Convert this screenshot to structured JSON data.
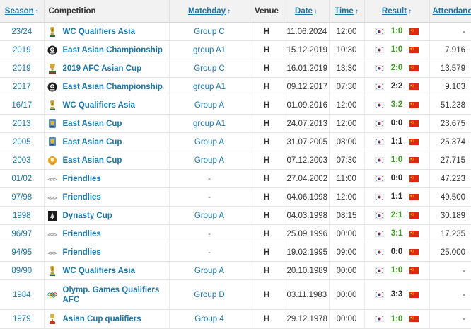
{
  "header": {
    "season": "Season",
    "competition": "Competition",
    "matchday": "Matchday",
    "venue": "Venue",
    "date": "Date",
    "time": "Time",
    "result": "Result",
    "attendance": "Attendance",
    "sort_icon": "↕",
    "sort_active_icon": "↓"
  },
  "rows": [
    {
      "season": "23/24",
      "competition": "WC Qualifiers Asia",
      "logo": "wc-icon",
      "matchday": "Group C",
      "venue": "H",
      "date": "11.06.2024",
      "time": "12:00",
      "result": "1:0",
      "outcome": "w",
      "attendance": "-"
    },
    {
      "season": "2019",
      "competition": "East Asian Championship",
      "logo": "eaff-icon",
      "matchday": "group A1",
      "venue": "H",
      "date": "15.12.2019",
      "time": "10:30",
      "result": "1:0",
      "outcome": "w",
      "attendance": "7.916"
    },
    {
      "season": "2019",
      "competition": "2019 AFC Asian Cup",
      "logo": "afc-icon",
      "matchday": "Group C",
      "venue": "H",
      "date": "16.01.2019",
      "time": "13:30",
      "result": "2:0",
      "outcome": "w",
      "attendance": "13.579"
    },
    {
      "season": "2017",
      "competition": "East Asian Championship",
      "logo": "eaff-icon",
      "matchday": "group A1",
      "venue": "H",
      "date": "09.12.2017",
      "time": "07:30",
      "result": "2:2",
      "outcome": "d",
      "attendance": "9.103"
    },
    {
      "season": "16/17",
      "competition": "WC Qualifiers Asia",
      "logo": "wc-icon",
      "matchday": "Group A",
      "venue": "H",
      "date": "01.09.2016",
      "time": "12:00",
      "result": "3:2",
      "outcome": "w",
      "attendance": "51.238"
    },
    {
      "season": "2013",
      "competition": "East Asian Cup",
      "logo": "eac-icon",
      "matchday": "group A1",
      "venue": "H",
      "date": "24.07.2013",
      "time": "12:00",
      "result": "0:0",
      "outcome": "d",
      "attendance": "23.675"
    },
    {
      "season": "2005",
      "competition": "East Asian Cup",
      "logo": "eac-icon",
      "matchday": "Group A",
      "venue": "H",
      "date": "31.07.2005",
      "time": "08:00",
      "result": "1:1",
      "outcome": "d",
      "attendance": "25.374"
    },
    {
      "season": "2003",
      "competition": "East Asian Cup",
      "logo": "eac-gold-icon",
      "matchday": "Group A",
      "venue": "H",
      "date": "07.12.2003",
      "time": "07:30",
      "result": "1:0",
      "outcome": "w",
      "attendance": "27.715"
    },
    {
      "season": "01/02",
      "competition": "Friendlies",
      "logo": "friendlies-icon",
      "matchday": "-",
      "venue": "H",
      "date": "27.04.2002",
      "time": "11:00",
      "result": "0:0",
      "outcome": "d",
      "attendance": "47.223"
    },
    {
      "season": "97/98",
      "competition": "Friendlies",
      "logo": "friendlies-icon",
      "matchday": "-",
      "venue": "H",
      "date": "04.06.1998",
      "time": "12:00",
      "result": "1:1",
      "outcome": "d",
      "attendance": "49.500"
    },
    {
      "season": "1998",
      "competition": "Dynasty Cup",
      "logo": "dynasty-icon",
      "matchday": "Group A",
      "venue": "H",
      "date": "04.03.1998",
      "time": "08:15",
      "result": "2:1",
      "outcome": "w",
      "attendance": "30.189"
    },
    {
      "season": "96/97",
      "competition": "Friendlies",
      "logo": "friendlies-icon",
      "matchday": "-",
      "venue": "H",
      "date": "25.09.1996",
      "time": "00:00",
      "result": "3:1",
      "outcome": "w",
      "attendance": "17.235"
    },
    {
      "season": "94/95",
      "competition": "Friendlies",
      "logo": "friendlies-icon",
      "matchday": "-",
      "venue": "H",
      "date": "19.02.1995",
      "time": "09:00",
      "result": "0:0",
      "outcome": "d",
      "attendance": "25.000"
    },
    {
      "season": "89/90",
      "competition": "WC Qualifiers Asia",
      "logo": "wc-icon",
      "matchday": "Group A",
      "venue": "H",
      "date": "20.10.1989",
      "time": "00:00",
      "result": "1:0",
      "outcome": "w",
      "attendance": "-"
    },
    {
      "season": "1984",
      "competition": "Olymp. Games Qualifiers AFC",
      "logo": "olympic-rings-icon",
      "matchday": "Group D",
      "venue": "H",
      "date": "03.11.1983",
      "time": "00:00",
      "result": "3:3",
      "outcome": "d",
      "attendance": "-"
    },
    {
      "season": "1979",
      "competition": "Asian Cup qualifiers",
      "logo": "asian-cup-icon",
      "matchday": "Group 4",
      "venue": "H",
      "date": "29.12.1978",
      "time": "00:00",
      "result": "1:0",
      "outcome": "w",
      "attendance": "-"
    }
  ],
  "colors": {
    "link": "#1d75a3",
    "win": "#3c9e22",
    "draw": "#2a2a2a",
    "header_bg": "#f2f2f2"
  },
  "flags": {
    "home": "south-korea-flag-icon",
    "away": "china-flag-icon"
  }
}
